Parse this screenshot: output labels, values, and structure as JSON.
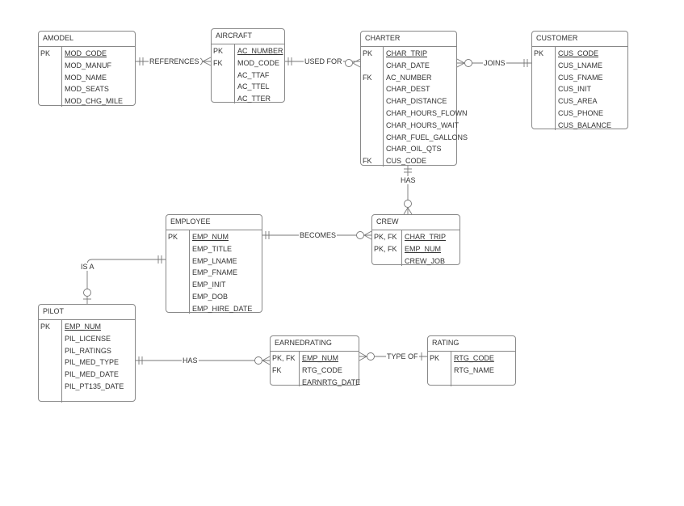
{
  "entities": [
    {
      "id": "amodel",
      "title": "AMODEL",
      "rows": [
        {
          "key": "PK",
          "field": "MOD_CODE",
          "pk": true
        },
        {
          "key": "",
          "field": "MOD_MANUF"
        },
        {
          "key": "",
          "field": "MOD_NAME"
        },
        {
          "key": "",
          "field": "MOD_SEATS"
        },
        {
          "key": "",
          "field": "MOD_CHG_MILE"
        }
      ]
    },
    {
      "id": "aircraft",
      "title": "AIRCRAFT",
      "rows": [
        {
          "key": "PK",
          "field": "AC_NUMBER",
          "pk": true
        },
        {
          "key": "FK",
          "field": "MOD_CODE"
        },
        {
          "key": "",
          "field": "AC_TTAF"
        },
        {
          "key": "",
          "field": "AC_TTEL"
        },
        {
          "key": "",
          "field": "AC_TTER"
        }
      ]
    },
    {
      "id": "charter",
      "title": "CHARTER",
      "rows": [
        {
          "key": "PK",
          "field": "CHAR_TRIP",
          "pk": true
        },
        {
          "key": "",
          "field": "CHAR_DATE"
        },
        {
          "key": "FK",
          "field": "AC_NUMBER"
        },
        {
          "key": "",
          "field": "CHAR_DEST"
        },
        {
          "key": "",
          "field": "CHAR_DISTANCE"
        },
        {
          "key": "",
          "field": "CHAR_HOURS_FLOWN"
        },
        {
          "key": "",
          "field": "CHAR_HOURS_WAIT"
        },
        {
          "key": "",
          "field": "CHAR_FUEL_GALLONS"
        },
        {
          "key": "",
          "field": "CHAR_OIL_QTS"
        },
        {
          "key": "FK",
          "field": "CUS_CODE"
        }
      ]
    },
    {
      "id": "customer",
      "title": "CUSTOMER",
      "rows": [
        {
          "key": "PK",
          "field": "CUS_CODE",
          "pk": true
        },
        {
          "key": "",
          "field": "CUS_LNAME"
        },
        {
          "key": "",
          "field": "CUS_FNAME"
        },
        {
          "key": "",
          "field": "CUS_INIT"
        },
        {
          "key": "",
          "field": "CUS_AREA"
        },
        {
          "key": "",
          "field": "CUS_PHONE"
        },
        {
          "key": "",
          "field": "CUS_BALANCE"
        }
      ]
    },
    {
      "id": "employee",
      "title": "EMPLOYEE",
      "rows": [
        {
          "key": "PK",
          "field": "EMP_NUM",
          "pk": true
        },
        {
          "key": "",
          "field": "EMP_TITLE"
        },
        {
          "key": "",
          "field": "EMP_LNAME"
        },
        {
          "key": "",
          "field": "EMP_FNAME"
        },
        {
          "key": "",
          "field": "EMP_INIT"
        },
        {
          "key": "",
          "field": "EMP_DOB"
        },
        {
          "key": "",
          "field": "EMP_HIRE_DATE"
        }
      ]
    },
    {
      "id": "crew",
      "title": "CREW",
      "rows": [
        {
          "key": "PK, FK",
          "field": "CHAR_TRIP",
          "pk": true
        },
        {
          "key": "PK, FK",
          "field": "EMP_NUM",
          "pk": true
        },
        {
          "key": "",
          "field": "CREW_JOB"
        }
      ]
    },
    {
      "id": "pilot",
      "title": "PILOT",
      "rows": [
        {
          "key": "PK",
          "field": "EMP_NUM",
          "pk": true
        },
        {
          "key": "",
          "field": "PIL_LICENSE"
        },
        {
          "key": "",
          "field": "PIL_RATINGS"
        },
        {
          "key": "",
          "field": "PIL_MED_TYPE"
        },
        {
          "key": "",
          "field": "PIL_MED_DATE"
        },
        {
          "key": "",
          "field": "PIL_PT135_DATE"
        },
        {
          "key": "",
          "field": ""
        }
      ]
    },
    {
      "id": "earnedrating",
      "title": "EARNEDRATING",
      "rows": [
        {
          "key": "PK, FK",
          "field": "EMP_NUM",
          "pk": true
        },
        {
          "key": "FK",
          "field": "RTG_CODE"
        },
        {
          "key": "",
          "field": "EARNRTG_DATE"
        }
      ]
    },
    {
      "id": "rating",
      "title": "RATING",
      "rows": [
        {
          "key": "PK",
          "field": "RTG_CODE",
          "pk": true
        },
        {
          "key": "",
          "field": "RTG_NAME"
        },
        {
          "key": "",
          "field": ""
        }
      ]
    }
  ],
  "relationships": [
    {
      "id": "references",
      "label": "REFERENCES",
      "from": "AMODEL",
      "to": "AIRCRAFT"
    },
    {
      "id": "used_for",
      "label": "USED FOR",
      "from": "AIRCRAFT",
      "to": "CHARTER"
    },
    {
      "id": "joins",
      "label": "JOINS",
      "from": "CUSTOMER",
      "to": "CHARTER"
    },
    {
      "id": "has_crew",
      "label": "HAS",
      "from": "CHARTER",
      "to": "CREW"
    },
    {
      "id": "becomes",
      "label": "BECOMES",
      "from": "EMPLOYEE",
      "to": "CREW"
    },
    {
      "id": "is_a",
      "label": "IS A",
      "from": "EMPLOYEE",
      "to": "PILOT"
    },
    {
      "id": "has_rating",
      "label": "HAS",
      "from": "PILOT",
      "to": "EARNEDRATING"
    },
    {
      "id": "type_of",
      "label": "TYPE OF",
      "from": "RATING",
      "to": "EARNEDRATING"
    }
  ],
  "colors": {
    "line": "#888888",
    "text": "#333333"
  }
}
